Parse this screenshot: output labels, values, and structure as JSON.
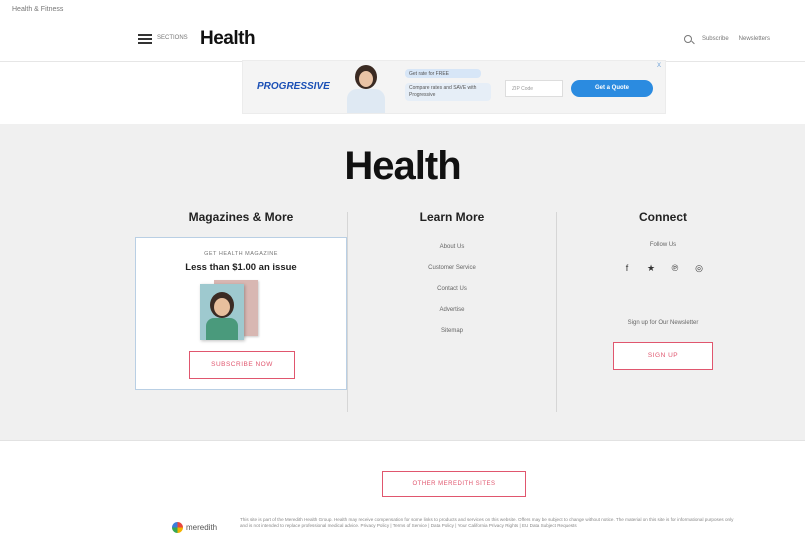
{
  "top_note": "Health & Fitness",
  "header": {
    "menu_label": "SECTIONS",
    "logo": "Health",
    "right_links": [
      "Subscribe",
      "Newsletters"
    ]
  },
  "ad": {
    "brand": "PROGRESSIVE",
    "bubble1": "Get rate for FREE",
    "bubble2": "Compare rates and SAVE with Progressive",
    "input_placeholder": "ZIP Code",
    "cta": "Get a Quote",
    "close": "X"
  },
  "footer": {
    "logo": "Health",
    "magazines": {
      "title": "Magazines & More",
      "eyebrow": "GET HEALTH MAGAZINE",
      "price": "Less than $1.00 an issue",
      "button": "SUBSCRIBE NOW"
    },
    "learn": {
      "title": "Learn More",
      "links": [
        "About Us",
        "Customer Service",
        "Contact Us",
        "Advertise",
        "Sitemap"
      ]
    },
    "connect": {
      "title": "Connect",
      "follow": "Follow Us",
      "social_icons": [
        "facebook-icon",
        "twitter-icon",
        "pinterest-icon",
        "instagram-icon"
      ],
      "social_glyphs": [
        "f",
        "★",
        "℗",
        "◎"
      ],
      "newsletter": "Sign up for Our Newsletter",
      "button": "SIGN UP"
    }
  },
  "other_sites_button": "OTHER MEREDITH SITES",
  "meredith": "meredith",
  "legal": "This site is part of the Meredith Health Group. Health may receive compensation for some links to products and services on this website. Offers may be subject to change without notice. The material on this site is for informational purposes only and is not intended to replace professional medical advice. Privacy Policy | Terms of Service | Data Policy | Your California Privacy Rights | EU Data Subject Requests"
}
